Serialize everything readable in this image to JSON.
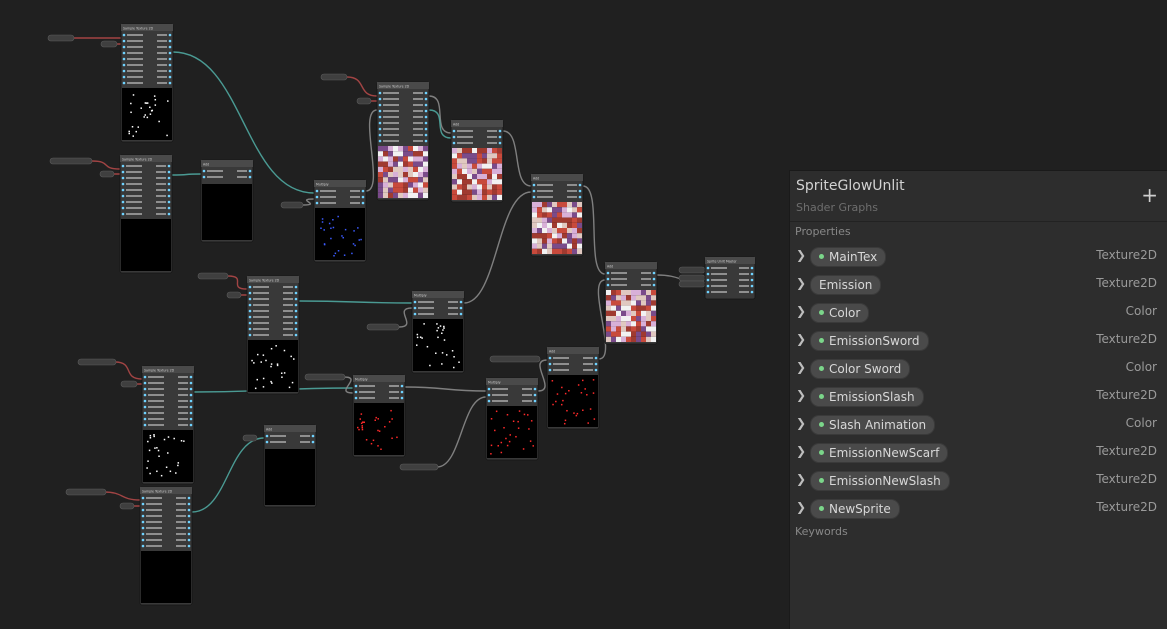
{
  "inspector": {
    "title": "SpriteGlowUnlit",
    "subtitle": "Shader Graphs",
    "add_label": "+",
    "properties_header": "Properties",
    "keywords_header": "Keywords",
    "properties": [
      {
        "name": "MainTex",
        "type": "Texture2D",
        "exposed": true
      },
      {
        "name": "Emission",
        "type": "Texture2D",
        "exposed": false
      },
      {
        "name": "Color",
        "type": "Color",
        "exposed": true
      },
      {
        "name": "EmissionSword",
        "type": "Texture2D",
        "exposed": true
      },
      {
        "name": "Color Sword",
        "type": "Color",
        "exposed": true
      },
      {
        "name": "EmissionSlash",
        "type": "Texture2D",
        "exposed": true
      },
      {
        "name": "Slash Animation",
        "type": "Color",
        "exposed": true
      },
      {
        "name": "EmissionNewScarf",
        "type": "Texture2D",
        "exposed": true
      },
      {
        "name": "EmissionNewSlash",
        "type": "Texture2D",
        "exposed": true
      },
      {
        "name": "NewSprite",
        "type": "Texture2D",
        "exposed": true
      }
    ]
  },
  "graph": {
    "nodes": [
      {
        "id": "st1",
        "title": "Sample Texture 2D",
        "preview": "white-dots"
      },
      {
        "id": "st2",
        "title": "Sample Texture 2D",
        "preview": "black"
      },
      {
        "id": "st3",
        "title": "Sample Texture 2D",
        "preview": "white-dots"
      },
      {
        "id": "st4",
        "title": "Sample Texture 2D",
        "preview": "white-dots"
      },
      {
        "id": "st5",
        "title": "Sample Texture 2D",
        "preview": "black"
      },
      {
        "id": "st6",
        "title": "Sample Texture 2D",
        "preview": "sprite"
      },
      {
        "id": "mul1",
        "title": "Multiply",
        "preview": "blue-dots"
      },
      {
        "id": "mul2",
        "title": "Multiply",
        "preview": "white-dots"
      },
      {
        "id": "mul3",
        "title": "Multiply",
        "preview": "red-dots"
      },
      {
        "id": "mul4",
        "title": "Multiply",
        "preview": "red-dots"
      },
      {
        "id": "add1",
        "title": "Add",
        "preview": "black"
      },
      {
        "id": "add2",
        "title": "Add",
        "preview": "black"
      },
      {
        "id": "add3",
        "title": "Add",
        "preview": "red-dots"
      },
      {
        "id": "add4",
        "title": "Add",
        "preview": "sprite"
      },
      {
        "id": "add5",
        "title": "Add",
        "preview": "sprite"
      },
      {
        "id": "add6",
        "title": "Add",
        "preview": "sprite"
      },
      {
        "id": "master",
        "title": "Sprite Unlit Master",
        "preview": "none"
      }
    ],
    "colors": {
      "background": "#202020",
      "node": "#393939",
      "edge_grey": "#8a8a8a",
      "edge_teal": "#4fa7a0",
      "edge_red": "#b04848"
    }
  }
}
